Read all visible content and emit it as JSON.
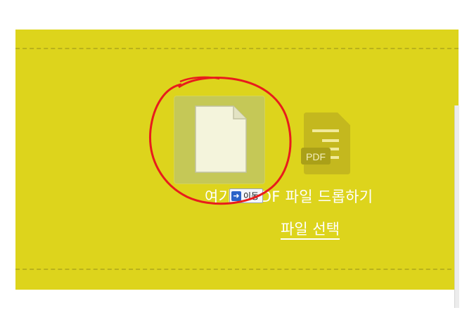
{
  "dropzone": {
    "main_text": "여기에 PDF 파일 드롭하기",
    "select_link": "파일 선택",
    "background_color": "#ddd41c"
  },
  "pdf_icon": {
    "label": "PDF"
  },
  "drag_tooltip": {
    "label": "이동",
    "icon": "move-arrow-icon"
  },
  "annotation": {
    "color": "#e81c1c",
    "shape": "hand-drawn-circle"
  }
}
